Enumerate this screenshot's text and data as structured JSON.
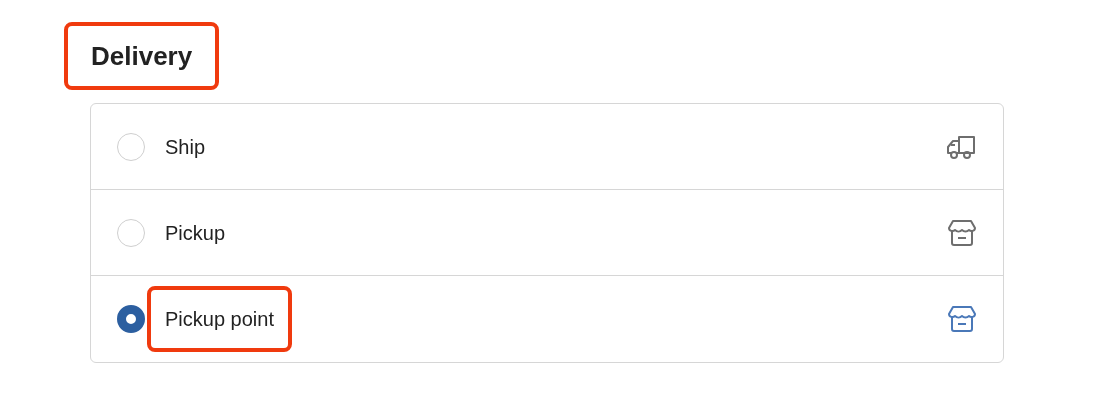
{
  "heading": {
    "text": "Delivery",
    "highlighted": true
  },
  "options": [
    {
      "label": "Ship",
      "kind": "ship",
      "selected": false,
      "highlighted": false
    },
    {
      "label": "Pickup",
      "kind": "pickup",
      "selected": false,
      "highlighted": false
    },
    {
      "label": "Pickup point",
      "kind": "pickup",
      "selected": true,
      "highlighted": true
    }
  ]
}
